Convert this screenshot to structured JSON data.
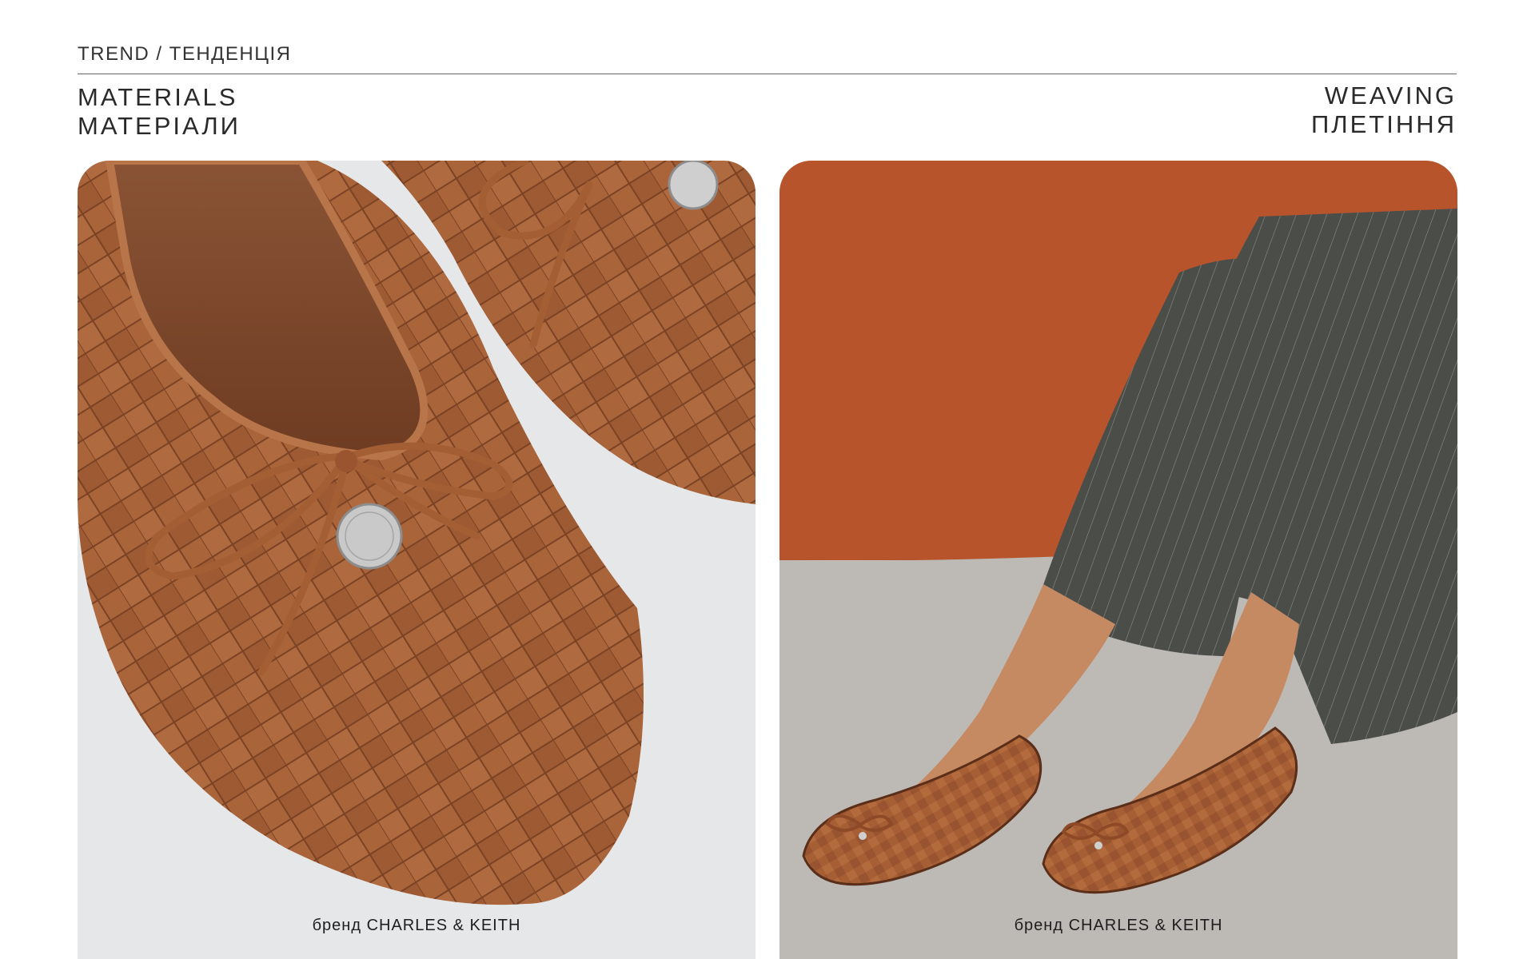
{
  "header": {
    "trend_label": "TREND / ТЕНДЕНЦІЯ",
    "section_en": "MATERIALS",
    "section_ua": "МАТЕРІАЛИ",
    "topic_en": "WEAVING",
    "topic_ua": "ПЛЕТІННЯ"
  },
  "photos": {
    "left_caption": "бренд CHARLES & KEITH",
    "right_caption": "бренд CHARLES & KEITH"
  },
  "colors": {
    "leather_brown": "#a65f35",
    "terracotta_wall": "#b5512a",
    "concrete_floor": "#bdbab6",
    "trousers_grey": "#4d4f4b",
    "text": "#2a2a2a"
  }
}
